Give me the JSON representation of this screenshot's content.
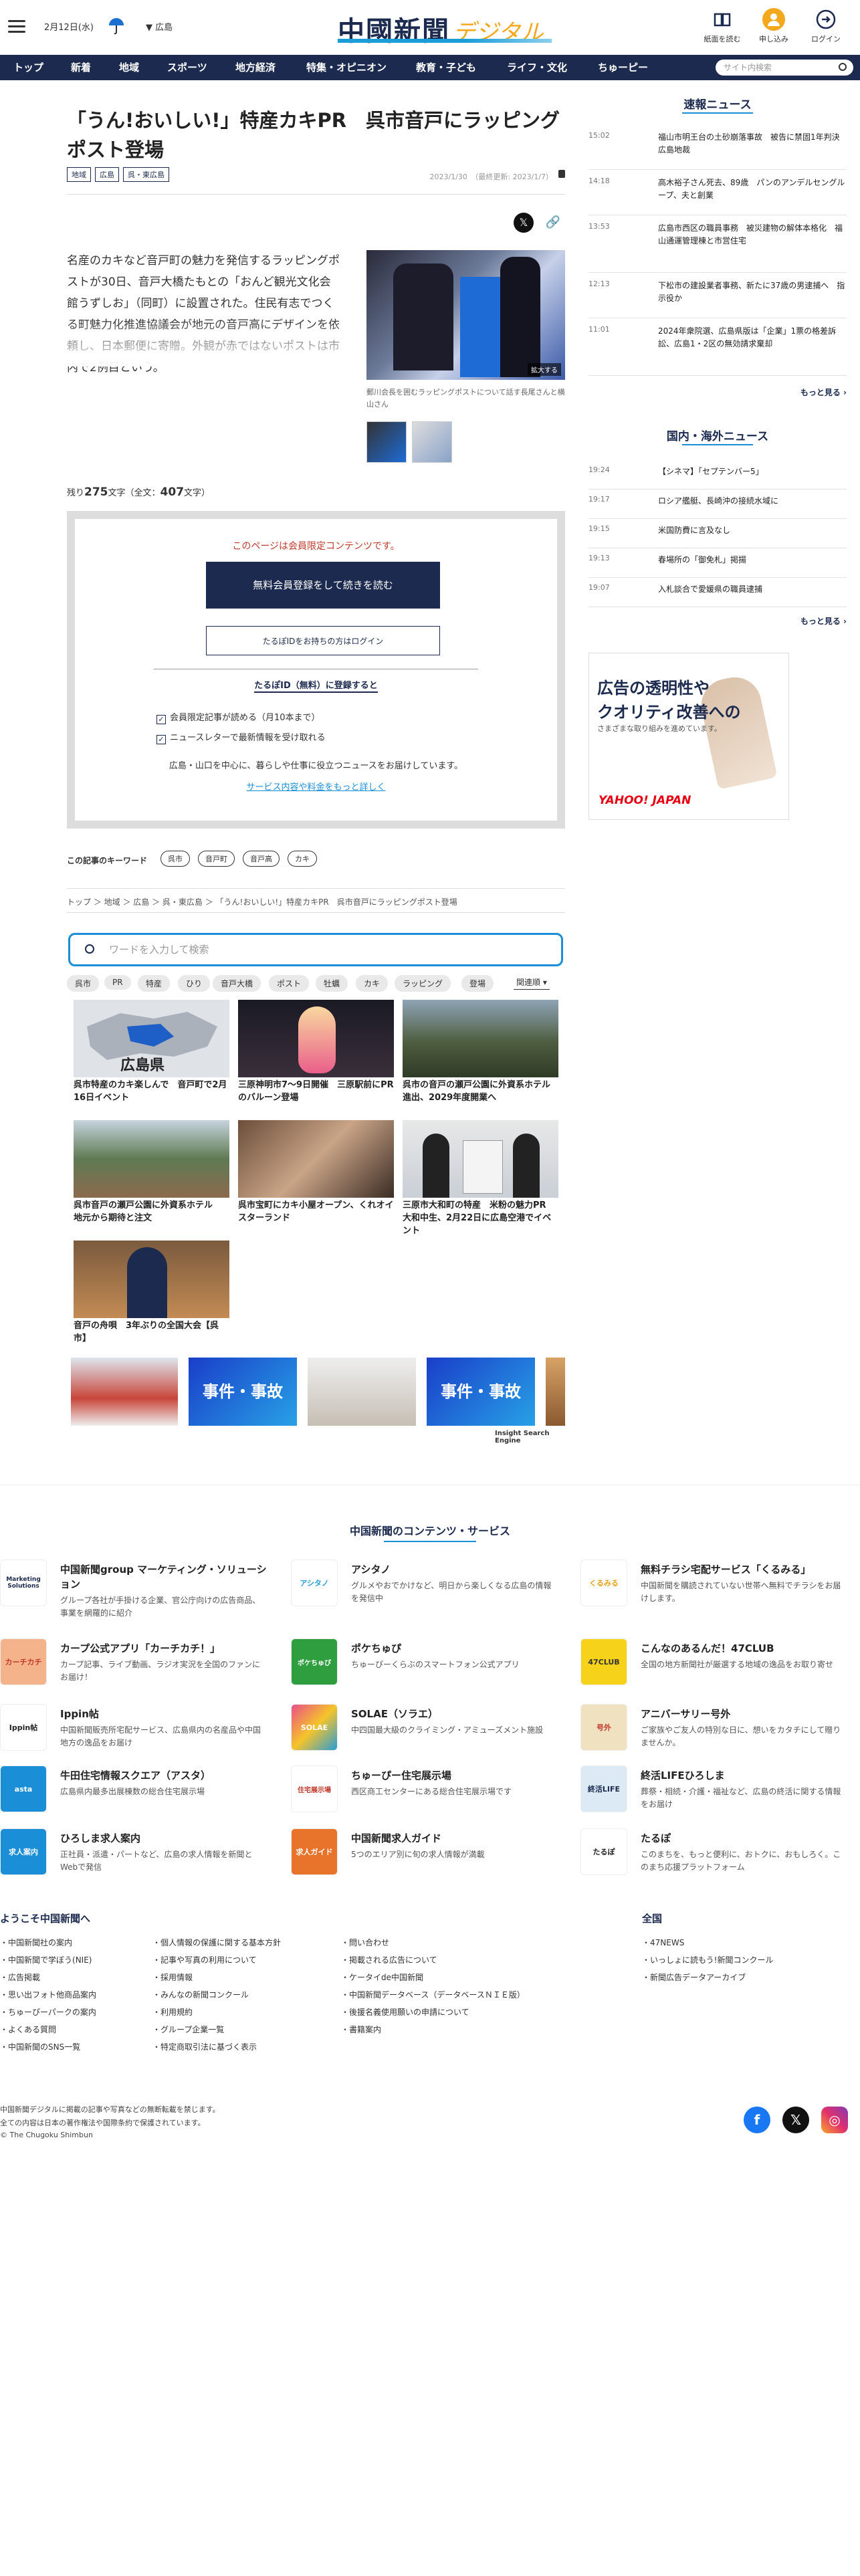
{
  "header": {
    "date": "2月12日(水)",
    "region": "広島",
    "logo_main": "中國新聞",
    "logo_sub": "デジタル",
    "icons": [
      {
        "label": "紙面を読む",
        "icon": "newspaper-icon"
      },
      {
        "label": "申し込み",
        "icon": "signup-icon"
      },
      {
        "label": "ログイン",
        "icon": "login-icon"
      }
    ]
  },
  "nav": {
    "items": [
      "トップ",
      "新着",
      "地域",
      "スポーツ",
      "地方経済",
      "特集・オピニオン",
      "教育・子ども",
      "ライフ・文化",
      "ちゅーピー"
    ],
    "search_placeholder": "サイト内検索"
  },
  "article": {
    "title": "「うん!おいしい!」特産カキPR　呉市音戸にラッピングポスト登場",
    "tags": [
      "地域",
      "広島",
      "呉・東広島"
    ],
    "published": "2023/1/30　（最終更新: 2023/1/7）",
    "lead": "名産のカキなど音戸町の魅力を発信するラッピングポストが30日、音戸大橋たもとの「おんど観光文化会館うずしお」（同町）に設置された。住民有志でつくる町魅力化推進協議会が地元の音戸高にデザインを依頼し、日本郵便に寄贈。外観が赤ではないポストは市内で2例目という。",
    "photo_zoom": "拡大する",
    "photo_caption": "郵川会長を囲むラッピングポストについて話す長尾さんと横山さん",
    "remaining_prefix": "残り",
    "remaining_count": "275",
    "remaining_mid": "文字（全文：",
    "total_count": "407",
    "remaining_suffix": "文字）"
  },
  "paywall": {
    "note": "このページは会員限定コンテンツです。",
    "register_button": "無料会員登録をして続きを読む",
    "login_button": "たるぽIDをお持ちの方はログイン",
    "id_heading": "たるぽID（無料）に登録すると",
    "benefits": [
      "会員限定記事が読める（月10本まで）",
      "ニュースレターで最新情報を受け取れる"
    ],
    "desc": "広島・山口を中心に、暮らしや仕事に役立つニュースをお届けしています。",
    "more_link": "サービス内容や料金をもっと詳しく"
  },
  "keywords": {
    "label": "この記事のキーワード",
    "items": [
      "呉市",
      "音戸町",
      "音戸高",
      "カキ"
    ]
  },
  "breadcrumb": "トップ ＞ 地域 ＞ 広島 ＞ 呉・東広島 ＞ 「うん!おいしい!」特産カキPR　呉市音戸にラッピングポスト登場",
  "related": {
    "search_placeholder": "ワードを入力して検索",
    "chips": [
      "呉市",
      "PR",
      "特産",
      "ひり",
      "音戸大橋",
      "ポスト",
      "牡蠣",
      "カキ",
      "ラッピング",
      "登場"
    ],
    "sort_label": "関連順",
    "cards": [
      {
        "title": "呉市特産のカキ楽しんで　音戸町で2月16日イベント",
        "img_label": "広島県"
      },
      {
        "title": "三原神明市7〜9日開催　三原駅前にPRのバルーン登場",
        "img_label": ""
      },
      {
        "title": "呉市の音戸の瀬戸公園に外資系ホテル進出、2029年度開業へ",
        "img_label": ""
      },
      {
        "title": "呉市音戸の瀬戸公園に外資系ホテル　地元から期待と注文",
        "img_label": ""
      },
      {
        "title": "呉市宝町にカキ小屋オープン、くれオイスターランド",
        "img_label": ""
      },
      {
        "title": "三原市大和町の特産　米粉の魅力PR　大和中生、2月22日に広島空港でイベント",
        "img_label": ""
      },
      {
        "title": "音戸の舟唄　3年ぶりの全国大会【呉市】",
        "img_label": ""
      }
    ],
    "banners": [
      "",
      "事件・事故",
      "",
      "事件・事故",
      ""
    ],
    "engine": "Insight Search Engine"
  },
  "sidebar": {
    "breaking_title": "速報ニュース",
    "breaking": [
      {
        "time": "15:02",
        "headline": "福山市明王台の土砂崩落事故　被告に禁固1年判決　広島地裁"
      },
      {
        "time": "14:18",
        "headline": "高木裕子さん死去、89歳　パンのアンデルセングループ、夫と創業"
      },
      {
        "time": "13:53",
        "headline": "広島市西区の職員事務　被災建物の解体本格化　福山通運管理棟と市営住宅"
      },
      {
        "time": "12:13",
        "headline": "下松市の建設業者事務、新たに37歳の男逮捕へ　指示役か"
      },
      {
        "time": "11:01",
        "headline": "2024年衆院選、広島県版は「企業」1票の格差訴訟、広島1・2区の無効請求棄却"
      }
    ],
    "breaking_more": "もっと見る ›",
    "world_title": "国内・海外ニュース",
    "world": [
      {
        "time": "19:24",
        "headline": "【シネマ】「セプテンバー5」"
      },
      {
        "time": "19:17",
        "headline": "ロシア艦艇、長崎沖の接続水域に"
      },
      {
        "time": "19:15",
        "headline": "米国防費に言及なし"
      },
      {
        "time": "19:13",
        "headline": "春場所の「御免札」掲揚"
      },
      {
        "time": "19:07",
        "headline": "入札談合で愛媛県の職員逮捕"
      }
    ],
    "world_more": "もっと見る ›",
    "ad": {
      "line1": "広告の透明性や",
      "line2": "クオリティ改善への",
      "line3": "さまざまな取り組みを進めています。",
      "brand": "YAHOO! JAPAN"
    }
  },
  "footer": {
    "services_title": "中国新聞のコンテンツ・サービス",
    "services": [
      {
        "name": "中国新聞group マーケティング・ソリューション",
        "desc": "グループ各社が手掛ける企業、官公庁向けの広告商品、事業を網羅的に紹介",
        "logo": "Marketing Solutions"
      },
      {
        "name": "アシタノ",
        "desc": "グルメやおでかけなど、明日から楽しくなる広島の情報を発信中",
        "logo": "アシタノ"
      },
      {
        "name": "無料チラシ宅配サービス「くるみる」",
        "desc": "中国新聞を購読されていない世帯へ無料でチラシをお届けします。",
        "logo": "くるみる"
      },
      {
        "name": "カープ公式アプリ「カーチカチ！」",
        "desc": "カープ記事、ライブ動画、ラジオ実況を全国のファンにお届け！",
        "logo": "カーチカチ"
      },
      {
        "name": "ポケちゅぴ",
        "desc": "ちゅーぴーくらぶのスマートフォン公式アプリ",
        "logo": "ポケちゅぴ"
      },
      {
        "name": "こんなのあるんだ！47CLUB",
        "desc": "全国の地方新聞社が厳選する地域の逸品をお取り寄せ",
        "logo": "47CLUB"
      },
      {
        "name": "Ippin帖",
        "desc": "中国新聞販売所宅配サービス、広島県内の名産品や中国地方の逸品をお届け",
        "logo": "Ippin帖"
      },
      {
        "name": "SOLAE（ソラエ）",
        "desc": "中四国最大級のクライミング・アミューズメント施設",
        "logo": "SOLAE"
      },
      {
        "name": "アニバーサリー号外",
        "desc": "ご家族やご友人の特別な日に、想いをカタチにして贈りませんか。",
        "logo": "号外"
      },
      {
        "name": "牛田住宅情報スクエア（アスタ）",
        "desc": "広島県内最多出展棟数の総合住宅展示場",
        "logo": "asta"
      },
      {
        "name": "ちゅーぴー住宅展示場",
        "desc": "西区商工センターにある総合住宅展示場です",
        "logo": "住宅展示場"
      },
      {
        "name": "終活LIFEひろしま",
        "desc": "葬祭・相続・介護・福祉など、広島の終活に関する情報をお届け",
        "logo": "終活LIFE"
      },
      {
        "name": "ひろしま求人案内",
        "desc": "正社員・派遣・パートなど、広島の求人情報を新聞とWebで発信",
        "logo": "求人案内"
      },
      {
        "name": "中国新聞求人ガイド",
        "desc": "5つのエリア別に旬の求人情報が満載",
        "logo": "求人ガイド"
      },
      {
        "name": "たるぽ",
        "desc": "このまちを、もっと便利に、おトクに、おもしろく。このまち応援プラットフォーム",
        "logo": "たるぽ"
      }
    ],
    "welcome_title": "ようこそ中国新聞へ",
    "links_col1": [
      "中国新聞社の案内",
      "中国新聞で学ぼう(NIE)",
      "広告掲載",
      "思い出フォト他商品案内",
      "ちゅーぴーパークの案内",
      "よくある質問",
      "中国新聞のSNS一覧"
    ],
    "links_col2": [
      "個人情報の保護に関する基本方針",
      "記事や写真の利用について",
      "採用情報",
      "みんなの新聞コンクール",
      "利用規約",
      "グループ企業一覧",
      "特定商取引法に基づく表示"
    ],
    "links_col3": [
      "問い合わせ",
      "掲載される広告について",
      "ケータイde中国新聞",
      "中国新聞データベース（データベースＮＩＥ版）",
      "後援名義使用願いの申請について",
      "書籍案内"
    ],
    "national_title": "全国",
    "links_col4": [
      "47NEWS",
      "いっしょに読もう!新聞コンクール",
      "新聞広告データアーカイブ"
    ],
    "copy1": "中国新聞デジタルに掲載の記事や写真などの無断転載を禁じます。",
    "copy2": "全ての内容は日本の著作権法や国際条約で保護されています。",
    "copy3": "© The Chugoku Shimbun"
  }
}
